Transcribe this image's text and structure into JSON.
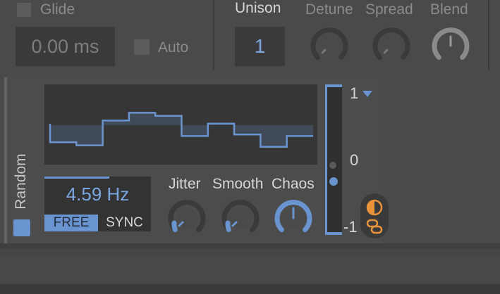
{
  "voice": {
    "glide_label": "Glide",
    "glide_value": "0.00 ms",
    "auto_label": "Auto",
    "unison_label": "Unison",
    "unison_value": "1",
    "detune_label": "Detune",
    "spread_label": "Spread",
    "blend_label": "Blend"
  },
  "lfo": {
    "name": "Random",
    "frequency": "4.59 Hz",
    "mode_free": "FREE",
    "mode_sync": "SYNC",
    "jitter_label": "Jitter",
    "smooth_label": "Smooth",
    "chaos_label": "Chaos",
    "depth_max": "1",
    "depth_mid": "0",
    "depth_min": "-1",
    "random_steps": [
      -0.55,
      -0.65,
      0.15,
      0.4,
      0.3,
      -0.35,
      0.05,
      -0.3,
      -0.7,
      -0.35
    ]
  },
  "colors": {
    "accent": "#6a94cf",
    "orange": "#e8923a",
    "background": "#4a4a4a"
  },
  "icons": {
    "dropdown": "triangle-down-icon",
    "bipolar": "half-circle-icon",
    "link": "chain-link-icon"
  }
}
